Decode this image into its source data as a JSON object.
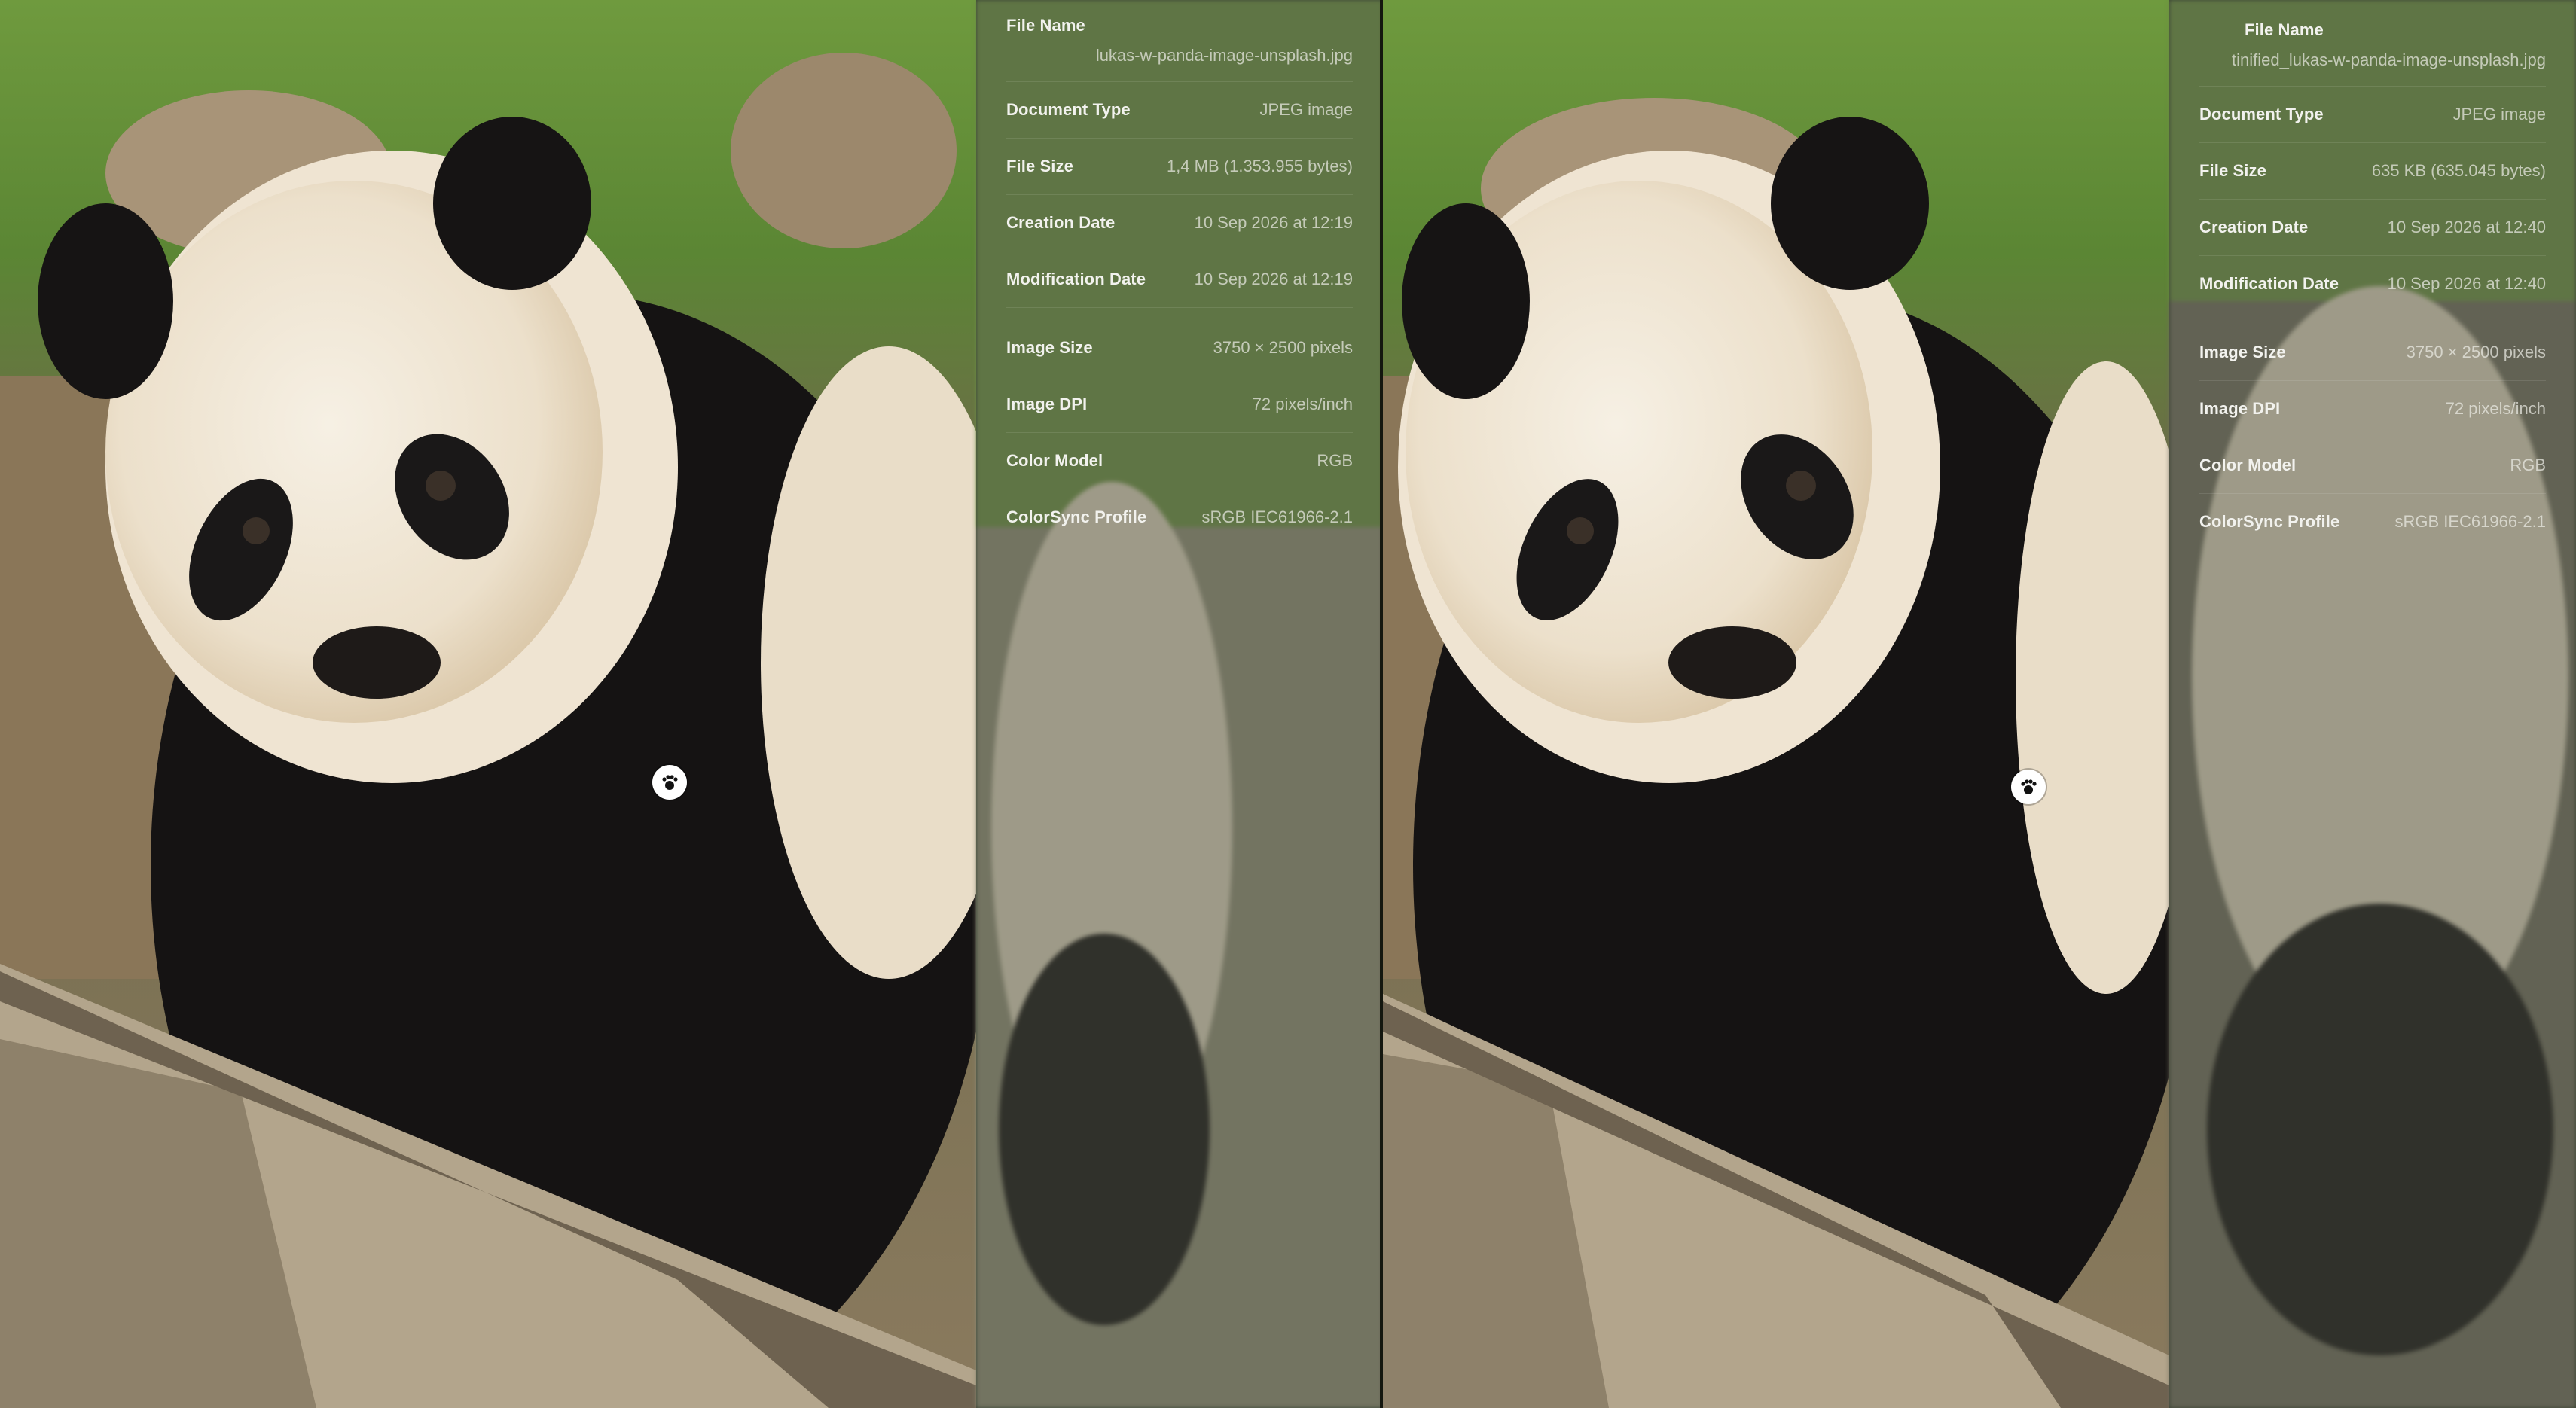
{
  "compare": {
    "left": {
      "file_name_label": "File Name",
      "file_name": "lukas-w-panda-image-unsplash.jpg",
      "details": [
        {
          "label": "Document Type",
          "value": "JPEG image"
        },
        {
          "label": "File Size",
          "value": "1,4 MB (1.353.955 bytes)"
        },
        {
          "label": "Creation Date",
          "value": "10 Sep 2026 at 12:19"
        },
        {
          "label": "Modification Date",
          "value": "10 Sep 2026 at 12:19"
        }
      ],
      "image_details": [
        {
          "label": "Image Size",
          "value": "3750 × 2500 pixels"
        },
        {
          "label": "Image DPI",
          "value": "72 pixels/inch"
        },
        {
          "label": "Color Model",
          "value": "RGB"
        },
        {
          "label": "ColorSync Profile",
          "value": "sRGB IEC61966-2.1"
        }
      ],
      "marker_icon": "paw-icon"
    },
    "right": {
      "file_name_label": "File Name",
      "file_name": "tinified_lukas-w-panda-image-unsplash.jpg",
      "details": [
        {
          "label": "Document Type",
          "value": "JPEG image"
        },
        {
          "label": "File Size",
          "value": "635 KB (635.045 bytes)"
        },
        {
          "label": "Creation Date",
          "value": "10 Sep 2026 at 12:40"
        },
        {
          "label": "Modification Date",
          "value": "10 Sep 2026 at 12:40"
        }
      ],
      "image_details": [
        {
          "label": "Image Size",
          "value": "3750 × 2500 pixels"
        },
        {
          "label": "Image DPI",
          "value": "72 pixels/inch"
        },
        {
          "label": "Color Model",
          "value": "RGB"
        },
        {
          "label": "ColorSync Profile",
          "value": "sRGB IEC61966-2.1"
        }
      ],
      "marker_icon": "paw-icon"
    }
  },
  "colors": {
    "grass": "#5e8a35",
    "fur_black": "#141212",
    "fur_white": "#efe6d6",
    "wood": "#a89a82"
  }
}
